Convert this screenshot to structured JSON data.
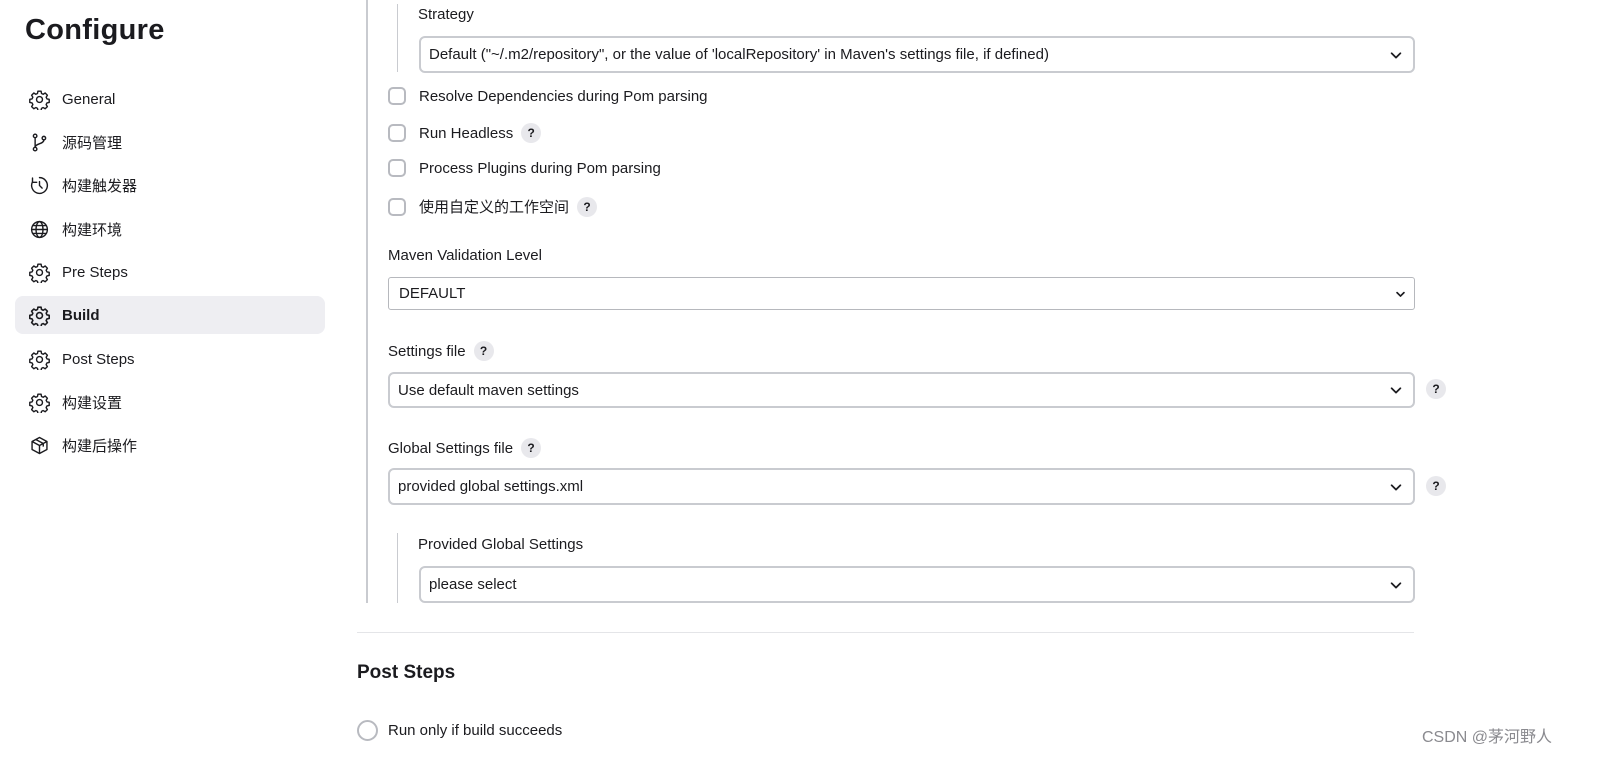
{
  "page_title": "Configure",
  "sidebar": {
    "items": [
      {
        "label": "General",
        "icon": "gear-icon"
      },
      {
        "label": "源码管理",
        "icon": "branch-icon"
      },
      {
        "label": "构建触发器",
        "icon": "clock-icon"
      },
      {
        "label": "构建环境",
        "icon": "globe-icon"
      },
      {
        "label": "Pre Steps",
        "icon": "gear-icon"
      },
      {
        "label": "Build",
        "icon": "gear-icon",
        "active": true
      },
      {
        "label": "Post Steps",
        "icon": "gear-icon"
      },
      {
        "label": "构建设置",
        "icon": "gear-icon"
      },
      {
        "label": "构建后操作",
        "icon": "package-icon"
      }
    ]
  },
  "build": {
    "strategy": {
      "label": "Strategy",
      "value": "Default (\"~/.m2/repository\", or the value of 'localRepository' in Maven's settings file, if defined)"
    },
    "checkboxes": {
      "resolve_dependencies": {
        "label": "Resolve Dependencies during Pom parsing",
        "checked": false
      },
      "run_headless": {
        "label": "Run Headless",
        "checked": false
      },
      "process_plugins": {
        "label": "Process Plugins during Pom parsing",
        "checked": false
      },
      "custom_workspace": {
        "label": "使用自定义的工作空间",
        "checked": false
      }
    },
    "validation_level": {
      "label": "Maven Validation Level",
      "value": "DEFAULT"
    },
    "settings_file": {
      "label": "Settings file",
      "value": "Use default maven settings"
    },
    "global_settings_file": {
      "label": "Global Settings file",
      "value": "provided global settings.xml"
    },
    "provided_global_settings": {
      "label": "Provided Global Settings",
      "value": "please select"
    },
    "help_glyph": "?"
  },
  "post_steps": {
    "title": "Post Steps",
    "run_only_if_success": {
      "label": "Run only if build succeeds",
      "selected": false
    }
  },
  "watermark": "CSDN @茅河野人"
}
